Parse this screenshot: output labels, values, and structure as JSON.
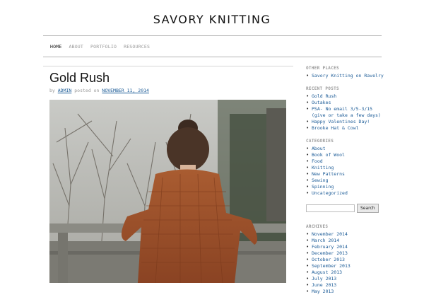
{
  "site": {
    "title": "SAVORY KNITTING"
  },
  "nav": {
    "home": "HOME",
    "about": "ABOUT",
    "portfolio": "PORTFOLIO",
    "resources": "RESOURCES"
  },
  "post": {
    "title": "Gold Rush",
    "by_label": "by",
    "author": "ADMIN",
    "posted_on_label": "posted on",
    "date": "NOVEMBER 11, 2014"
  },
  "sidebar": {
    "other_places": {
      "heading": "OTHER PLACES",
      "items": [
        "Savory Knitting on Ravelry"
      ]
    },
    "recent_posts": {
      "heading": "RECENT POSTS",
      "items": [
        "Gold Rush",
        "Outakes",
        "PSA- No email 3/5-3/15 (give or take a few days)",
        "Happy Valentines Day!",
        "Brooke Hat & Cowl"
      ]
    },
    "categories": {
      "heading": "CATEGORIES",
      "items": [
        "About",
        "Book of Wool",
        "Food",
        "Knitting",
        "New Patterns",
        "Sewing",
        "Spinning",
        "Uncategorized"
      ]
    },
    "search": {
      "value": "",
      "button": "Search"
    },
    "archives": {
      "heading": "ARCHIVES",
      "items": [
        "November 2014",
        "March 2014",
        "February 2014",
        "December 2013",
        "October 2013",
        "September 2013",
        "August 2013",
        "July 2013",
        "June 2013",
        "May 2013"
      ]
    }
  },
  "colors": {
    "link": "#1a5a96",
    "shawl": "#9a4f2a"
  }
}
